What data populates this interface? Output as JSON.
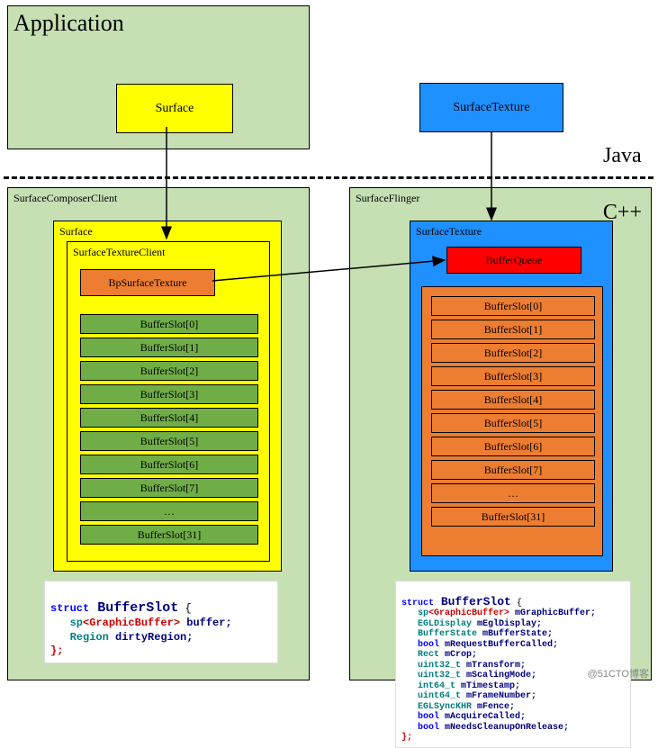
{
  "labels": {
    "application": "Application",
    "surface_java": "Surface",
    "surfacetexture_java": "SurfaceTexture",
    "java": "Java",
    "cpp": "C++",
    "scc": "SurfaceComposerClient",
    "surface_cpp": "Surface",
    "stc": "SurfaceTextureClient",
    "bpsurfacetexture": "BpSurfaceTexture",
    "sf": "SurfaceFlinger",
    "surfacetexture_cpp": "SurfaceTexture",
    "bufferqueue": "BufferQueue"
  },
  "slots_left": [
    "BufferSlot[0]",
    "BufferSlot[1]",
    "BufferSlot[2]",
    "BufferSlot[3]",
    "BufferSlot[4]",
    "BufferSlot[5]",
    "BufferSlot[6]",
    "BufferSlot[7]",
    "…",
    "BufferSlot[31]"
  ],
  "slots_right": [
    "BufferSlot[0]",
    "BufferSlot[1]",
    "BufferSlot[2]",
    "BufferSlot[3]",
    "BufferSlot[4]",
    "BufferSlot[5]",
    "BufferSlot[6]",
    "BufferSlot[7]",
    "…",
    "BufferSlot[31]"
  ],
  "code_left": {
    "l1a": "struct",
    "l1b": " BufferSlot",
    "l1c": " {",
    "l2a": "   sp",
    "l2b": "<GraphicBuffer>",
    "l2c": " buffer;",
    "l3a": "   Region",
    "l3b": " dirtyRegion;",
    "l4": "};"
  },
  "code_right": {
    "l1a": "struct",
    "l1b": " BufferSlot",
    "l1c": " {",
    "l2a": "   sp",
    "l2b": "<GraphicBuffer>",
    "l2c": " mGraphicBuffer;",
    "l3a": "   EGLDisplay",
    "l3b": " mEglDisplay;",
    "l4a": "   BufferState",
    "l4b": " mBufferState;",
    "l5a": "   bool",
    "l5b": " mRequestBufferCalled;",
    "l6a": "   Rect",
    "l6b": " mCrop;",
    "l7a": "   uint32_t",
    "l7b": " mTransform;",
    "l8a": "   uint32_t",
    "l8b": " mScalingMode;",
    "l9a": "   int64_t",
    "l9b": " mTimestamp;",
    "l10a": "   uint64_t",
    "l10b": " mFrameNumber;",
    "l11a": "   EGLSyncKHR",
    "l11b": " mFence;",
    "l12a": "   bool",
    "l12b": " mAcquireCalled;",
    "l13a": "   bool",
    "l13b": " mNeedsCleanupOnRelease;",
    "l14": "};"
  },
  "watermark": "@51CTO博客"
}
